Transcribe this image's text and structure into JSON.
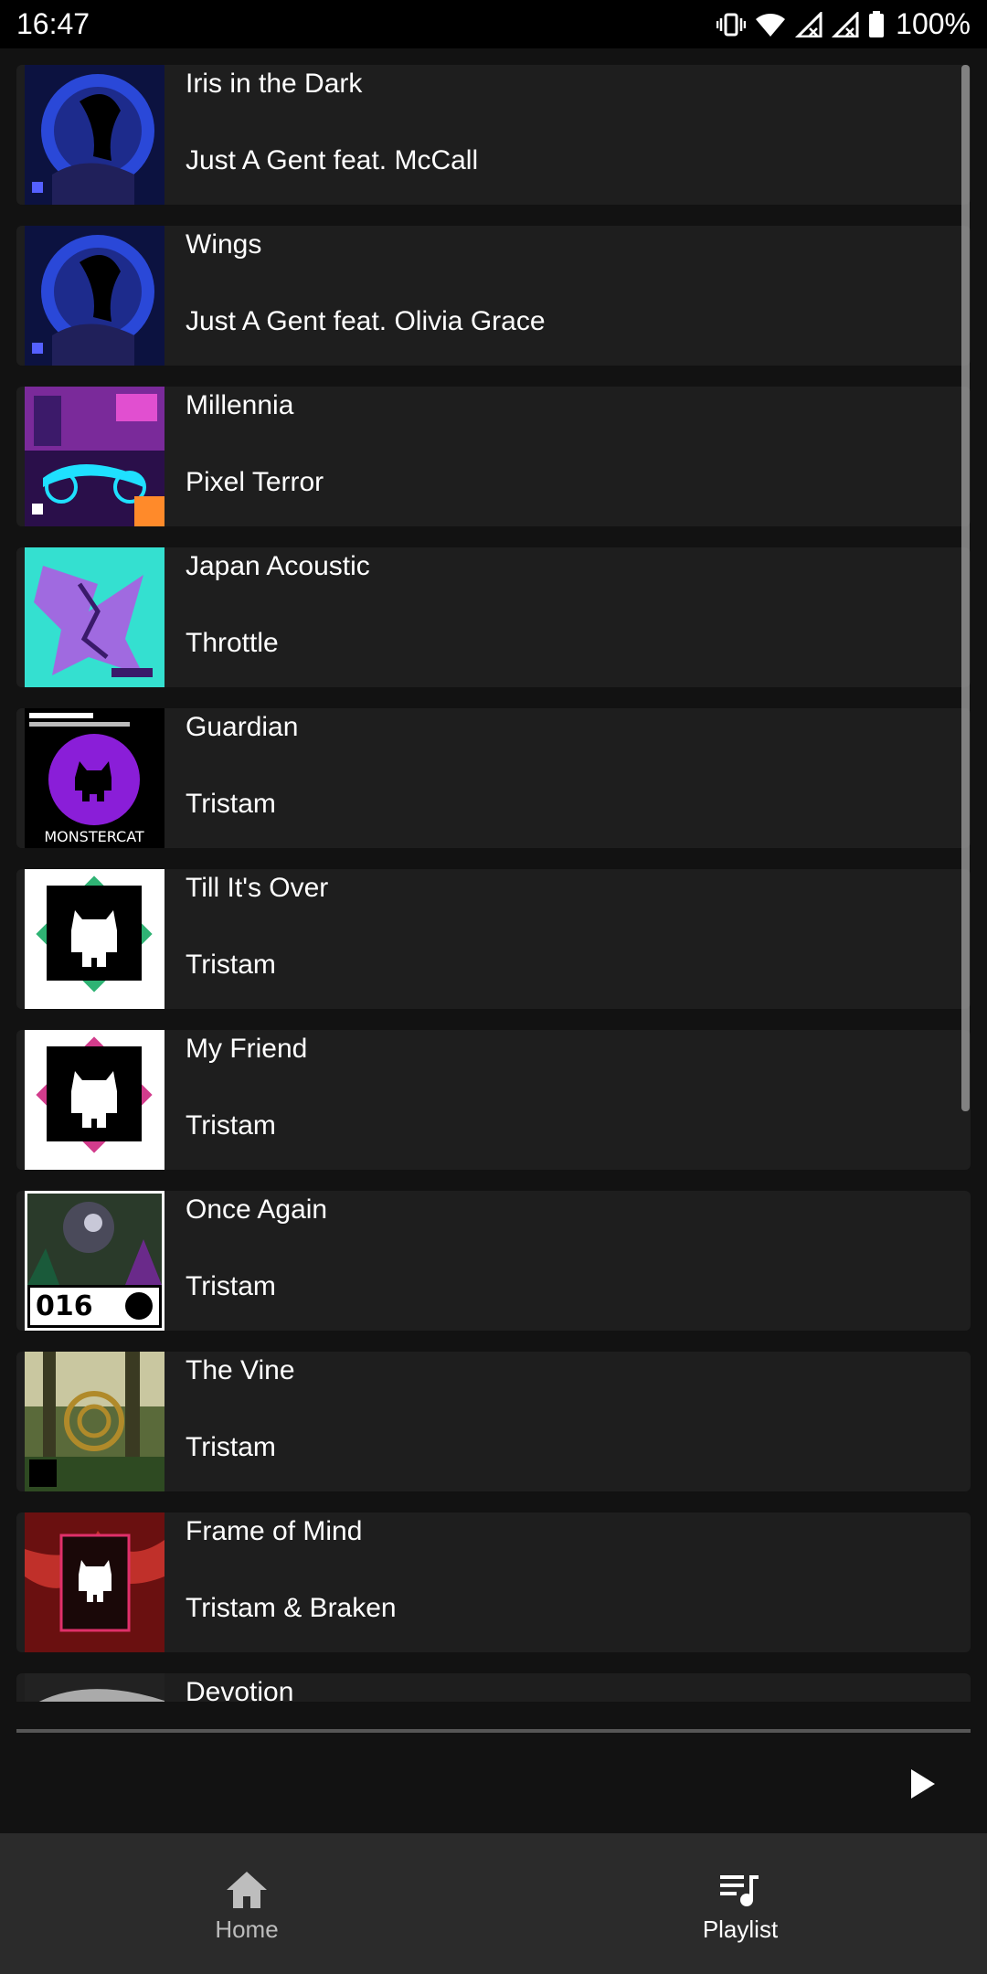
{
  "status_bar": {
    "time": "16:47",
    "battery": "100%",
    "icons": [
      "vibrate-icon",
      "wifi-icon",
      "signal-icon",
      "signal-icon",
      "battery-icon"
    ]
  },
  "tracks": [
    {
      "title": "Iris in the Dark",
      "artist": "Just A Gent feat. McCall",
      "art": "blue-night-art"
    },
    {
      "title": "Wings",
      "artist": "Just A Gent feat. Olivia Grace",
      "art": "blue-night-art"
    },
    {
      "title": "Millennia",
      "artist": "Pixel Terror",
      "art": "neon-city-art"
    },
    {
      "title": "Japan Acoustic",
      "artist": "Throttle",
      "art": "cyan-purple-art"
    },
    {
      "title": "Guardian",
      "artist": "Tristam",
      "art": "purple-monstercat-art"
    },
    {
      "title": "Till It's Over",
      "artist": "Tristam",
      "art": "green-diamond-art"
    },
    {
      "title": "My Friend",
      "artist": "Tristam",
      "art": "pink-diamond-art"
    },
    {
      "title": "Once Again",
      "artist": "Tristam",
      "art": "dark-forest-art"
    },
    {
      "title": "The Vine",
      "artist": "Tristam",
      "art": "forest-spiral-art"
    },
    {
      "title": "Frame of Mind",
      "artist": "Tristam & Braken",
      "art": "red-frame-art"
    },
    {
      "title": "Devotion",
      "artist": "",
      "art": "grey-art"
    }
  ],
  "album_art_text": {
    "guardian": "MONSTERCAT",
    "once_again": "016"
  },
  "player": {
    "play_icon": "play-icon"
  },
  "nav": {
    "home_label": "Home",
    "playlist_label": "Playlist",
    "active": "Playlist"
  },
  "colors": {
    "background": "#121212",
    "row": "#1e1e1e",
    "nav_bg": "#2b2b2b",
    "text": "#ffffff",
    "inactive_nav": "#bdbdbd"
  }
}
